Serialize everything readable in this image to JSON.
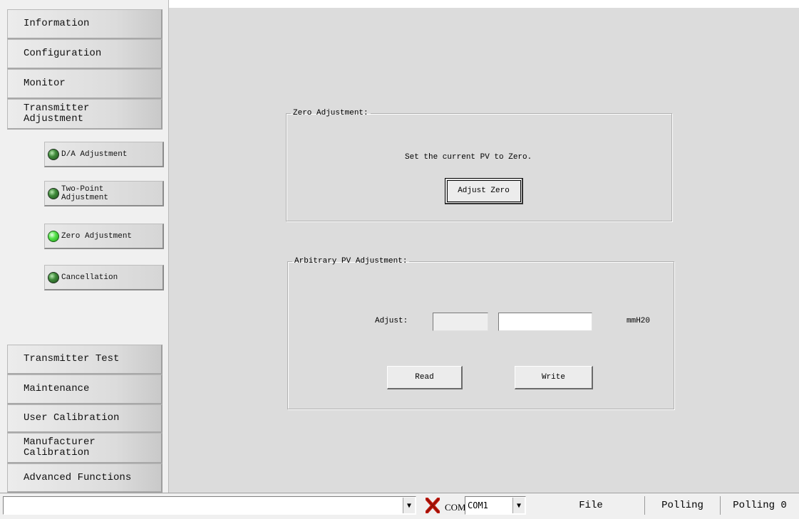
{
  "sidebar": {
    "items": [
      {
        "label": "Information"
      },
      {
        "label": "Configuration"
      },
      {
        "label": "Monitor"
      },
      {
        "label": "Transmitter\nAdjustment"
      },
      {
        "label": "Transmitter Test"
      },
      {
        "label": "Maintenance"
      },
      {
        "label": "User Calibration"
      },
      {
        "label": "Manufacturer\nCalibration"
      },
      {
        "label": "Advanced Functions"
      }
    ],
    "subitems": [
      {
        "label": "D/A Adjustment",
        "active": false
      },
      {
        "label": "Two-Point\nAdjustment",
        "active": false
      },
      {
        "label": "Zero Adjustment",
        "active": true
      },
      {
        "label": "Cancellation",
        "active": false
      }
    ]
  },
  "zero": {
    "legend": "Zero Adjustment:",
    "text": "Set the current PV to Zero.",
    "button": "Adjust Zero"
  },
  "arbitrary": {
    "legend": "Arbitrary PV Adjustment:",
    "adjust_label": "Adjust:",
    "value1": "",
    "value2": "",
    "unit": "mmH20",
    "read_button": "Read",
    "write_button": "Write"
  },
  "statusbar": {
    "port_value": "",
    "com_label": "COM:",
    "com_value": "COM1",
    "file": "File",
    "polling": "Polling",
    "polling_count": "Polling 0"
  },
  "colors": {
    "led_on": "#56e24a",
    "led_off": "#3f8a3a",
    "disconnect_icon": "#c0180c"
  }
}
